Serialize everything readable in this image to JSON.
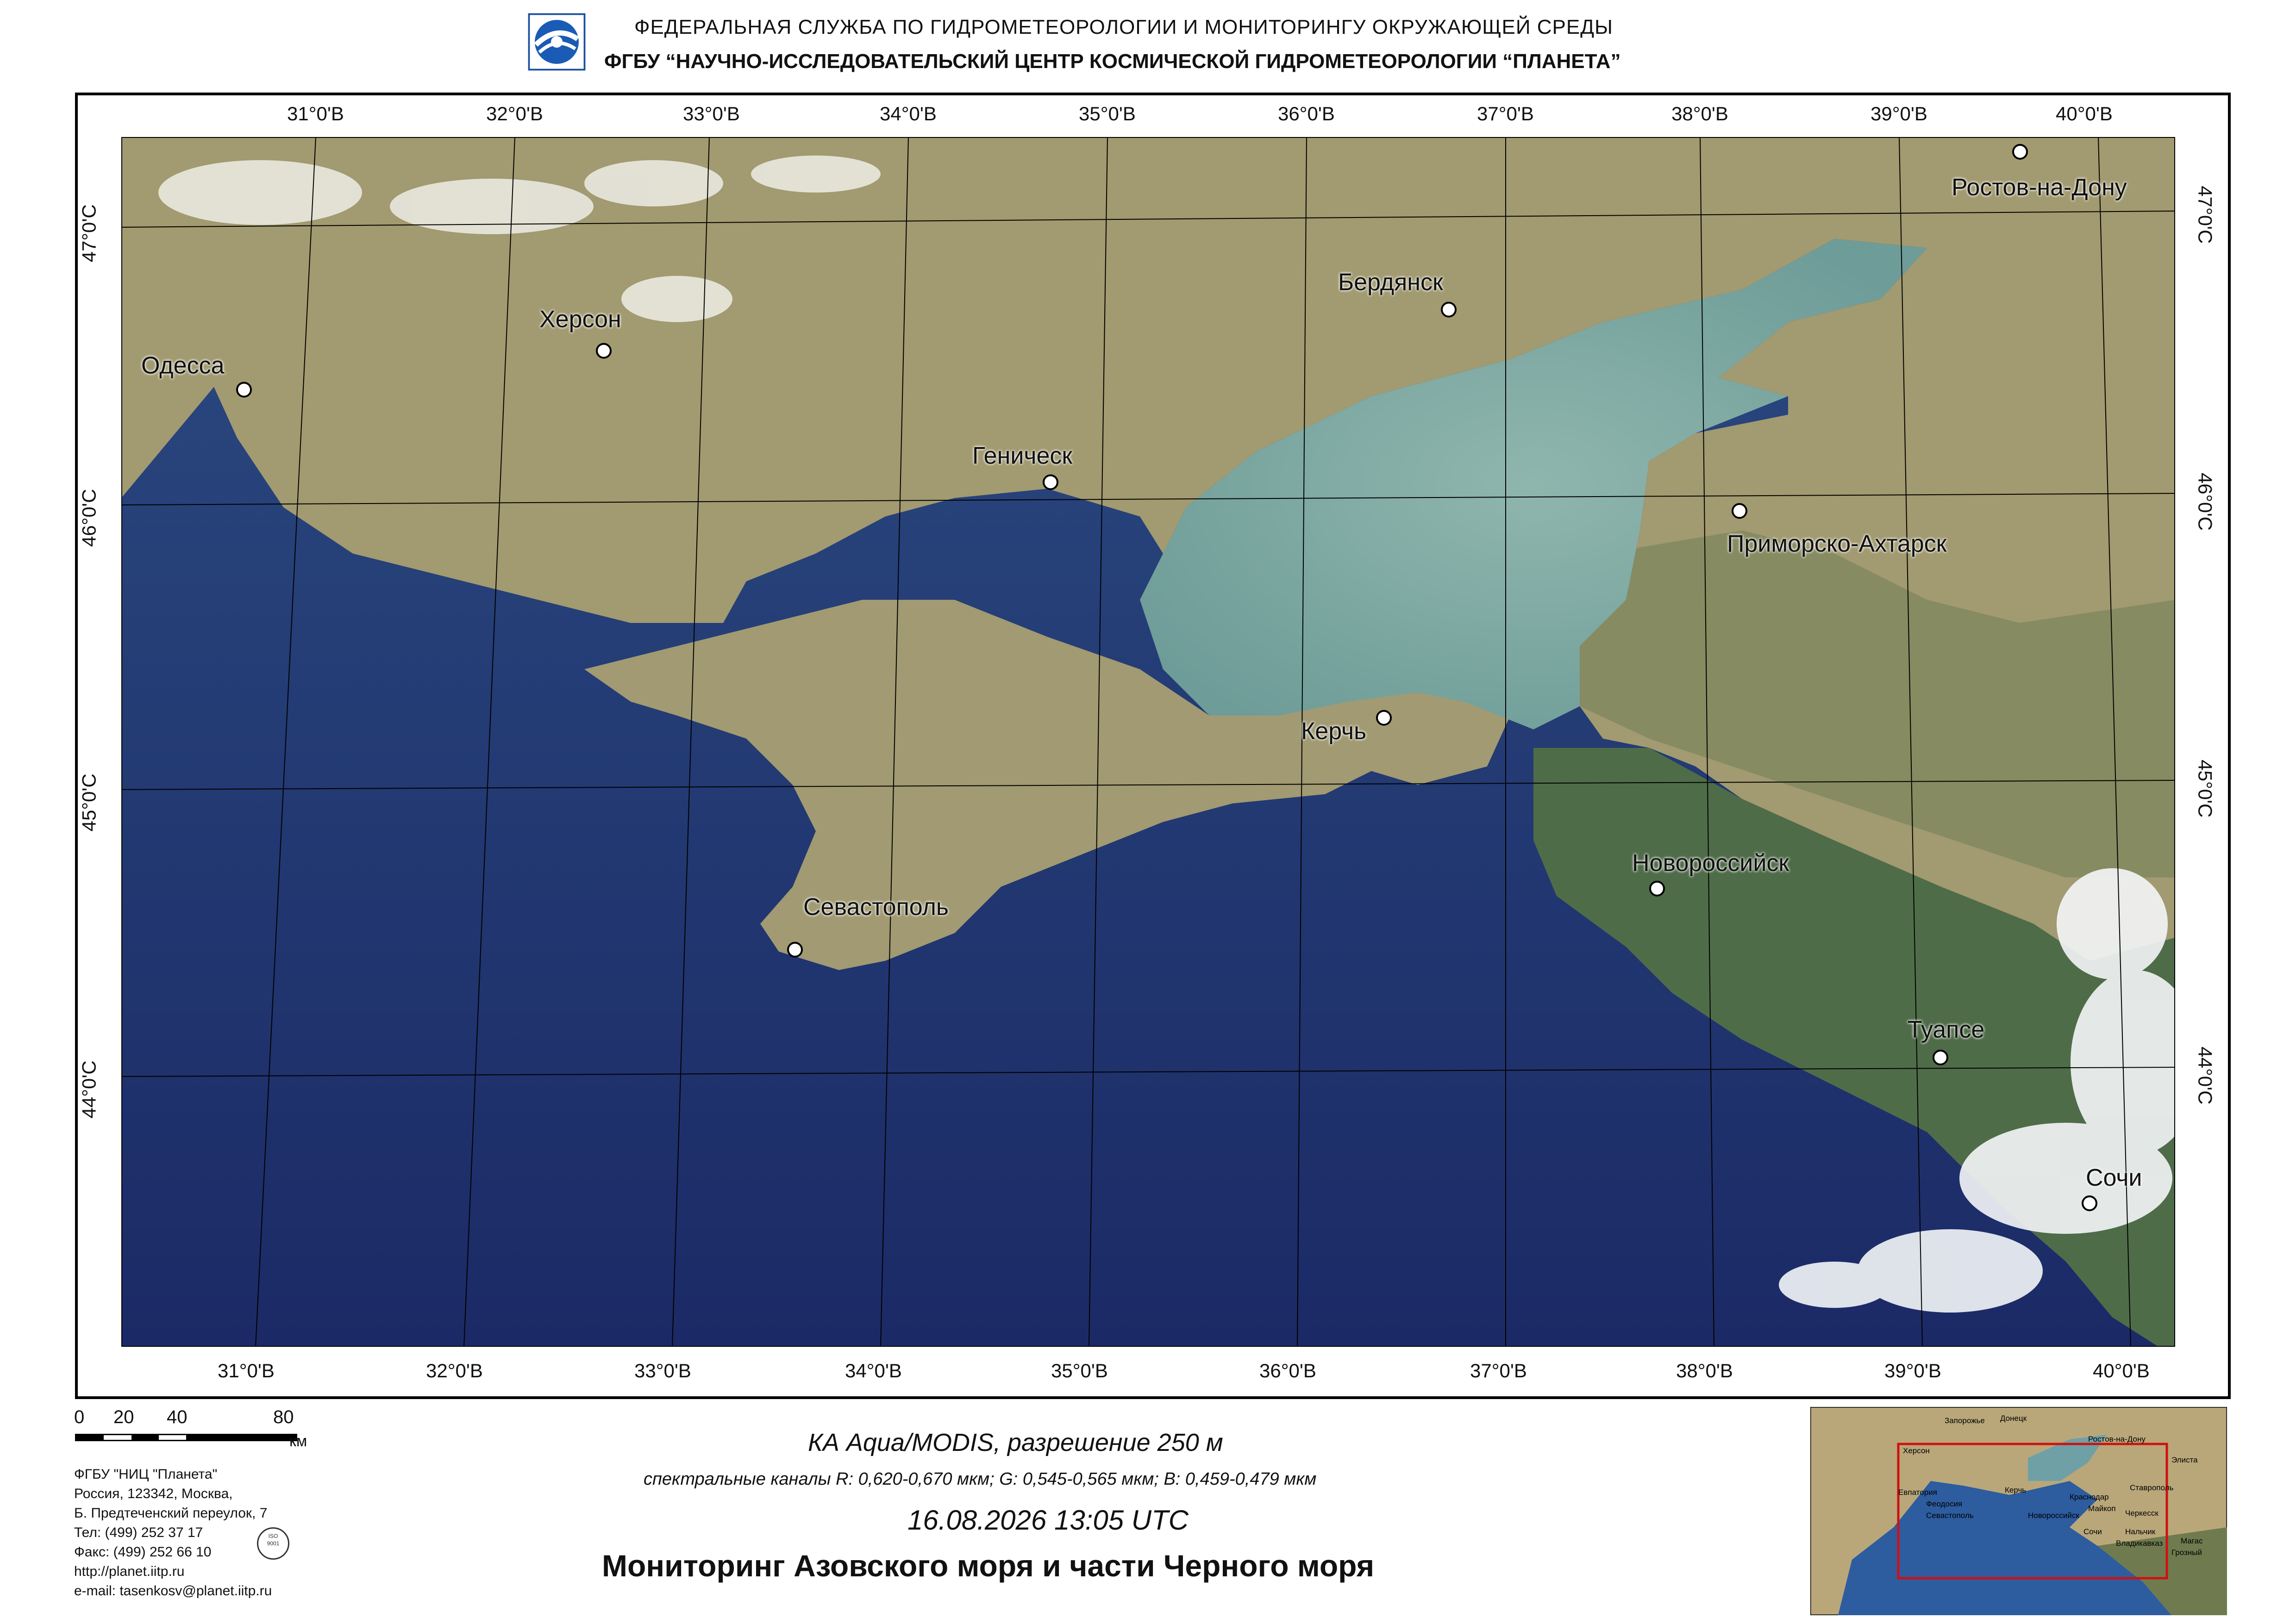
{
  "header": {
    "line1": "ФЕДЕРАЛЬНАЯ  СЛУЖБА  ПО ГИДРОМЕТЕОРОЛОГИИ И МОНИТОРИНГУ ОКРУЖАЮЩЕЙ СРЕДЫ",
    "line2": "ФГБУ “НАУЧНО-ИССЛЕДОВАТЕЛЬСКИЙ ЦЕНТР КОСМИЧЕСКОЙ ГИДРОМЕТЕОРОЛОГИИ “ПЛАНЕТА”",
    "logo_icon": "planeta-logo-icon"
  },
  "map": {
    "top_lon": [
      "31°0'В",
      "32°0'В",
      "33°0'В",
      "34°0'В",
      "35°0'В",
      "36°0'В",
      "37°0'В",
      "38°0'В",
      "39°0'В",
      "40°0'В"
    ],
    "bottom_lon": [
      "31°0'В",
      "32°0'В",
      "33°0'В",
      "34°0'В",
      "35°0'В",
      "36°0'В",
      "37°0'В",
      "38°0'В",
      "39°0'В",
      "40°0'В"
    ],
    "left_lat": [
      "47°0'С",
      "46°0'С",
      "45°0'С",
      "44°0'С"
    ],
    "right_lat": [
      "47°0'С",
      "46°0'С",
      "45°0'С",
      "44°0'С"
    ],
    "cities": [
      "Одесса",
      "Херсон",
      "Геническ",
      "Бердянск",
      "Ростов-на-Дону",
      "Приморско-Ахтарск",
      "Керчь",
      "Новороссийск",
      "Севастополь",
      "Туапсе",
      "Сочи"
    ],
    "colors": {
      "sea_deep": "#1e2e6e",
      "sea_azov": "#7fa9a4",
      "land": "#a39a6e",
      "forest": "#4d6b45",
      "cloud": "#ffffff"
    }
  },
  "scale": {
    "ticks": [
      "0",
      "20",
      "40",
      "80"
    ],
    "unit": "км"
  },
  "org": {
    "name": "ФГБУ \"НИЦ \"Планета\"",
    "addr1": "Россия, 123342,  Москва,",
    "addr2": "Б. Предтеченский переулок, 7",
    "tel": "Тел: (499) 252 37 17",
    "fax": "Факс: (499) 252 66 10",
    "web": "http://planet.iitp.ru",
    "email": "e-mail: tasenkosv@planet.iitp.ru"
  },
  "caption": {
    "satellite": "КА Aqua/MODIS, разрешение 250 м",
    "bands": "спектральные каналы R: 0,620-0,670 мкм; G: 0,545-0,565 мкм;  B: 0,459-0,479 мкм",
    "datetime": "16.08.2026    13:05 UTC",
    "title": "Мониторинг Азовского моря и части Черного моря"
  },
  "inset": {
    "labels": [
      "Запорожье",
      "Донецк",
      "Херсон",
      "Ростов-на-Дону",
      "Элиста",
      "Евпатория",
      "Керчь",
      "Краснодар",
      "Ставрополь",
      "Феодосия",
      "Севастополь",
      "Майкоп",
      "Новороссийск",
      "Черкесск",
      "Сочи",
      "Нальчик",
      "Владикавказ",
      "Магас",
      "Грозный"
    ]
  }
}
